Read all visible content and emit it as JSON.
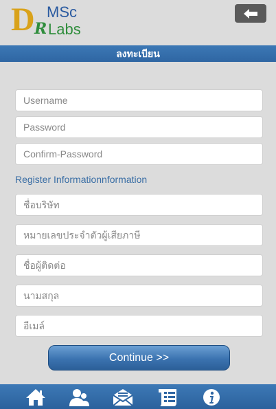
{
  "logo": {
    "d": "D",
    "r": "R",
    "msc": "MSc",
    "labs": "Labs"
  },
  "header": {
    "back_icon": "arrow-left-icon"
  },
  "title": "ลงทะเบียน",
  "form": {
    "username_placeholder": "Username",
    "password_placeholder": "Password",
    "confirm_placeholder": "Confirm-Password",
    "section_label": "Register Informationnformation",
    "company_placeholder": "ชื่อบริษัท",
    "taxid_placeholder": "หมายเลขประจำตัวผู้เสียภาษี",
    "contact_placeholder": "ชื่อผู้ติดต่อ",
    "lastname_placeholder": "นามสกุล",
    "email_placeholder": "อีเมล์"
  },
  "continue_label": "Continue >>",
  "bottom_nav": [
    {
      "icon": "home-icon"
    },
    {
      "icon": "users-icon"
    },
    {
      "icon": "mail-icon"
    },
    {
      "icon": "list-icon"
    },
    {
      "icon": "info-icon"
    }
  ],
  "colors": {
    "bar": "#2f66a3",
    "accent_text": "#3a6ea5",
    "background": "#dcdcdc"
  }
}
